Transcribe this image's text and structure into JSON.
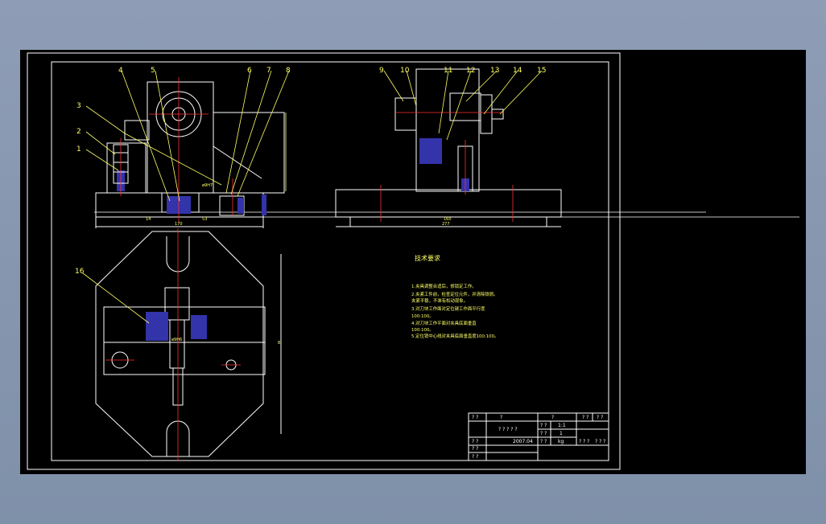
{
  "colors": {
    "background": "#000000",
    "frame": "#ffffff",
    "geometry": "#ffffff",
    "leaders": "#ffff66",
    "centerlines": "#ff3030",
    "parts": "#3333aa",
    "title_block": "#ffffff"
  },
  "balloons": [
    "1",
    "2",
    "3",
    "4",
    "5",
    "6",
    "7",
    "8",
    "9",
    "10",
    "11",
    "12",
    "13",
    "14",
    "15",
    "16"
  ],
  "dimensions": {
    "front_bottom": "170",
    "front_left": "14",
    "front_mid": "53",
    "side_bottom": "277",
    "side_mid": "160",
    "plan_height": "8"
  },
  "fits": {
    "front_fit": "ø9H7",
    "plan_fit": "ø9H6"
  },
  "tech_requirements": {
    "title": "技术要求",
    "lines": [
      "1.夹具调整合适后，修锁定工作。",
      "2.夹紧工件前，检查定位元件，并清除铁屑。",
      "  夹紧平稳，不准有松动现象。",
      "3.对刀块工作面对定位键工作面平行度",
      "  100:100。",
      "4.对刀块工作平面对夹具底面垂直",
      "  100:100。",
      "5.定位销中心线对夹具底面垂直度100:100。"
    ]
  },
  "title_block": {
    "row1": [
      "? ?",
      "?",
      "?",
      "? ?",
      "? ?"
    ],
    "part_name": "? ? ? ? ?",
    "scale_label": "? ?",
    "scale_value": "1:1",
    "qty_label": "? ?",
    "qty_value": "1",
    "designer_label": "? ?",
    "date": "2007.04",
    "weight_label": "? ?",
    "weight_unit": "kg",
    "sheet_a": "? ? ?",
    "sheet_b": "? ? ?",
    "checker_label": "? ?",
    "approver_label": "? ?"
  }
}
